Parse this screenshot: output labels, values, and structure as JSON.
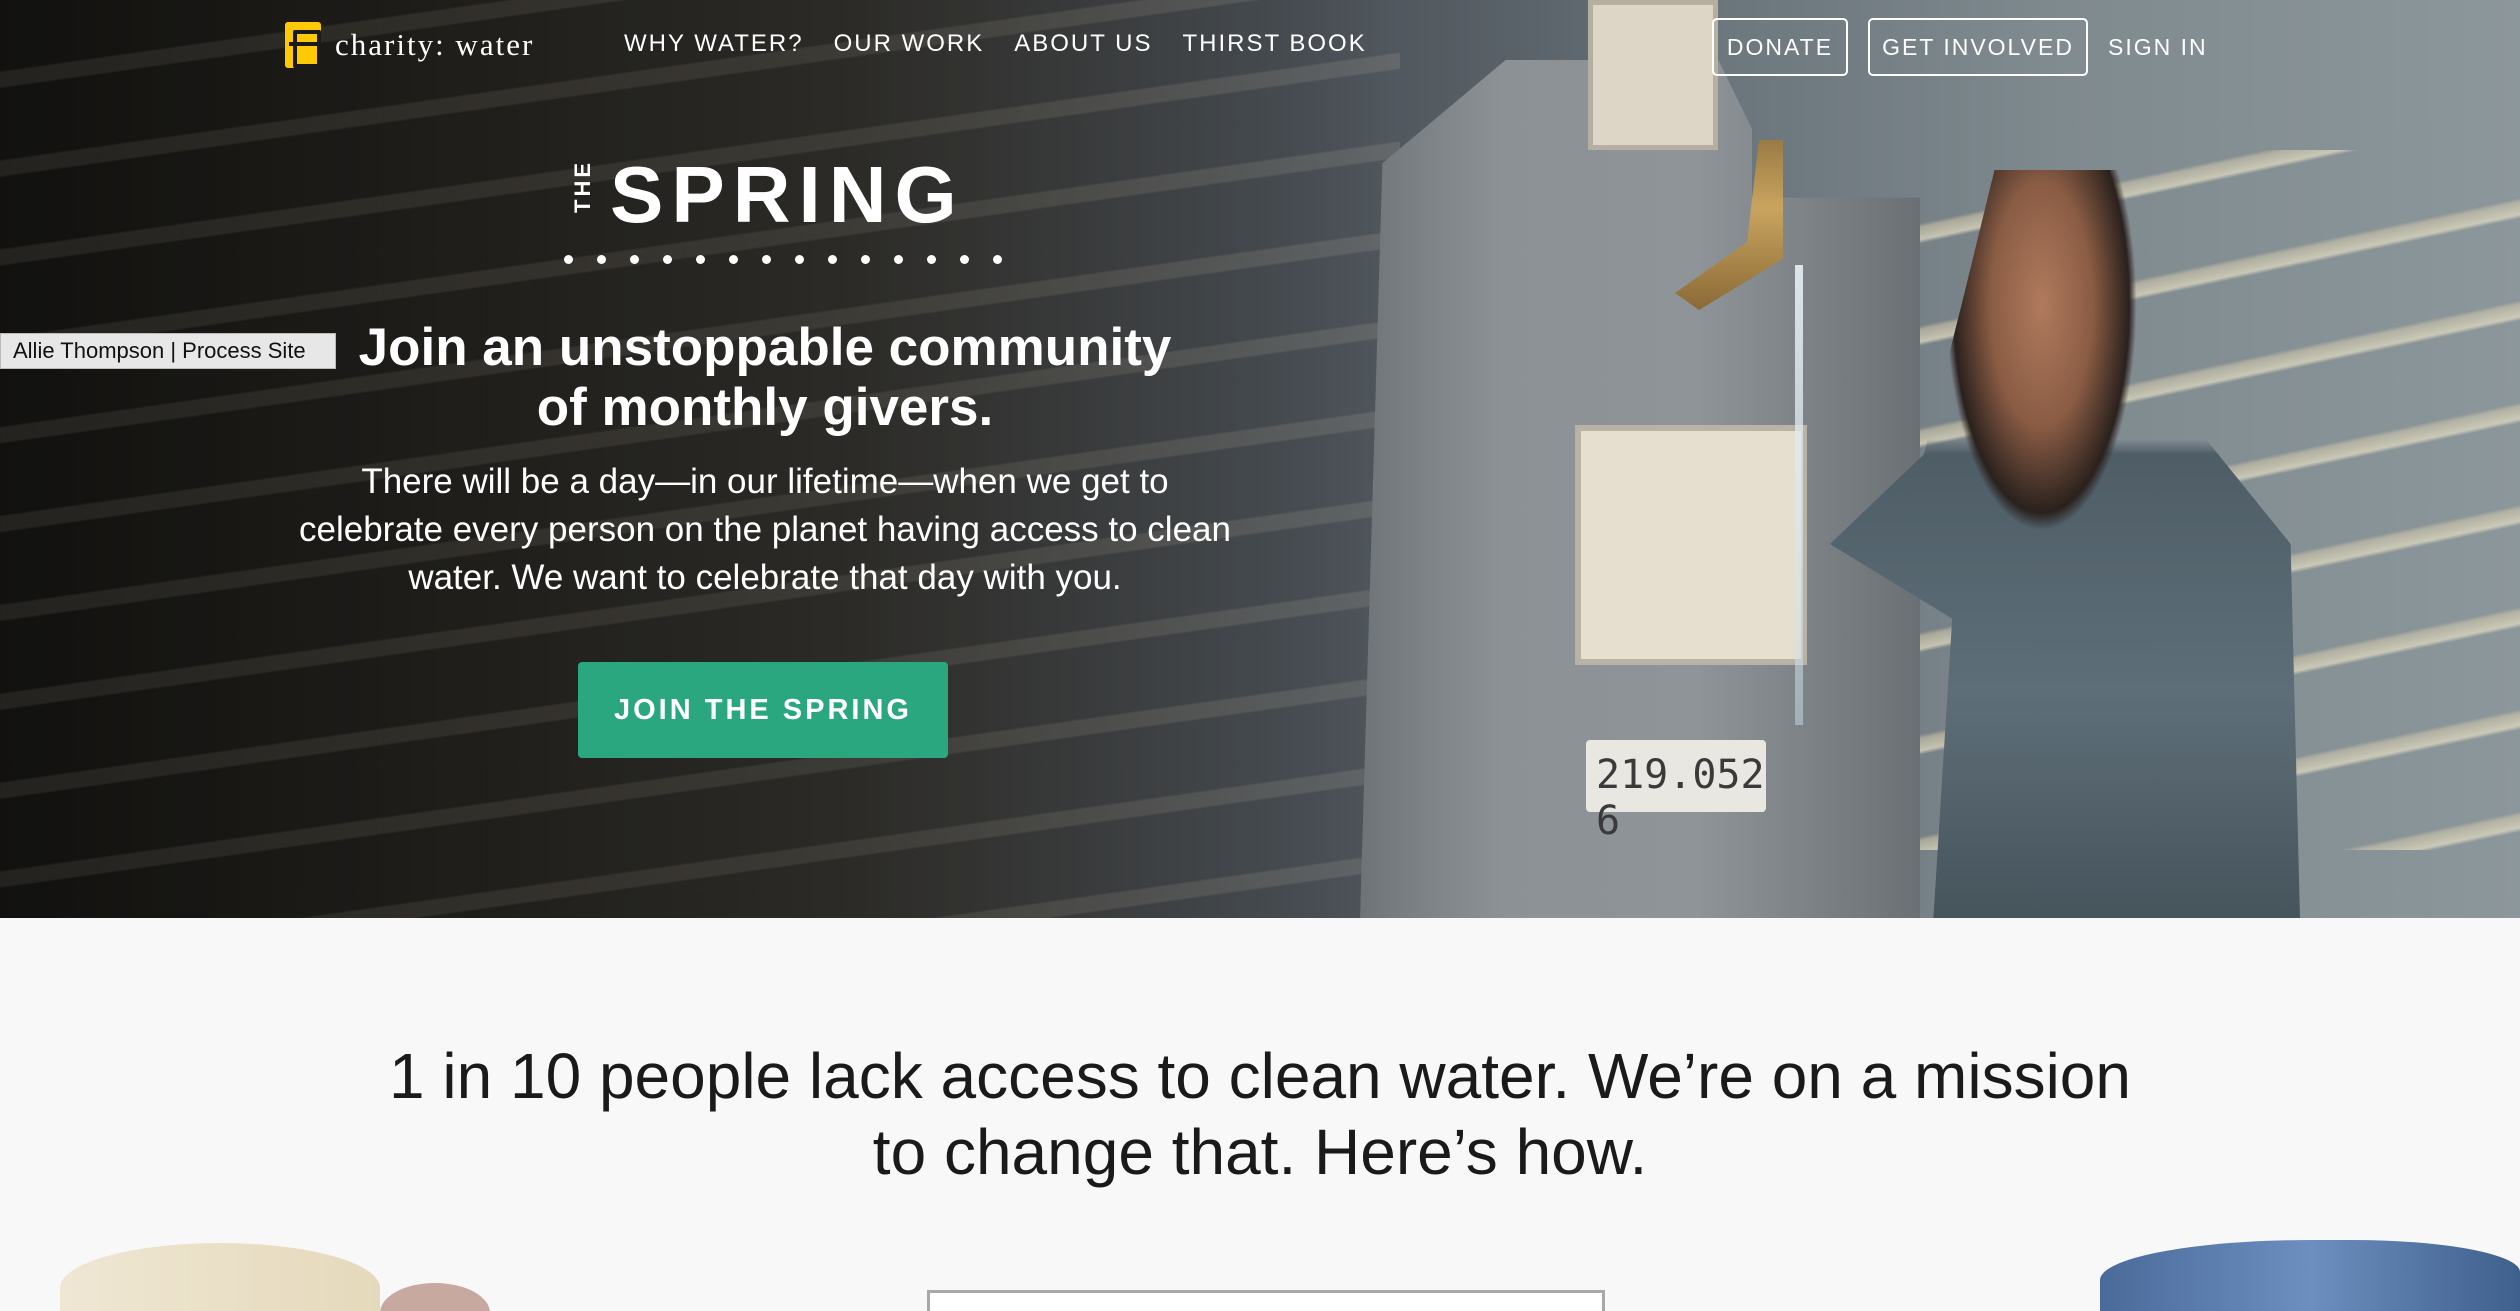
{
  "header": {
    "logo_text": "charity: water",
    "nav": [
      "WHY WATER?",
      "OUR WORK",
      "ABOUT US",
      "THIRST BOOK"
    ],
    "donate_label": "DONATE",
    "get_involved_label": "GET INVOLVED",
    "sign_in_label": "SIGN IN"
  },
  "hero": {
    "spring_prefix": "THE",
    "spring_title": "SPRING",
    "heading": "Join an unstoppable community of monthly givers.",
    "body": "There will be a day—in our lifetime—when we get to celebrate every person on the planet having access to clean water. We want to celebrate that day with you.",
    "cta_label": "JOIN THE SPRING",
    "plate_text": "219.052 6"
  },
  "overlay_label": "Allie Thompson | Process Site",
  "mission": {
    "heading": "1 in 10 people lack access to clean water. We’re on a mission to change that. Here’s how."
  },
  "colors": {
    "cta_green": "#2aa77e",
    "logo_yellow": "#ffc907",
    "page_bg": "#f8f8f8"
  }
}
